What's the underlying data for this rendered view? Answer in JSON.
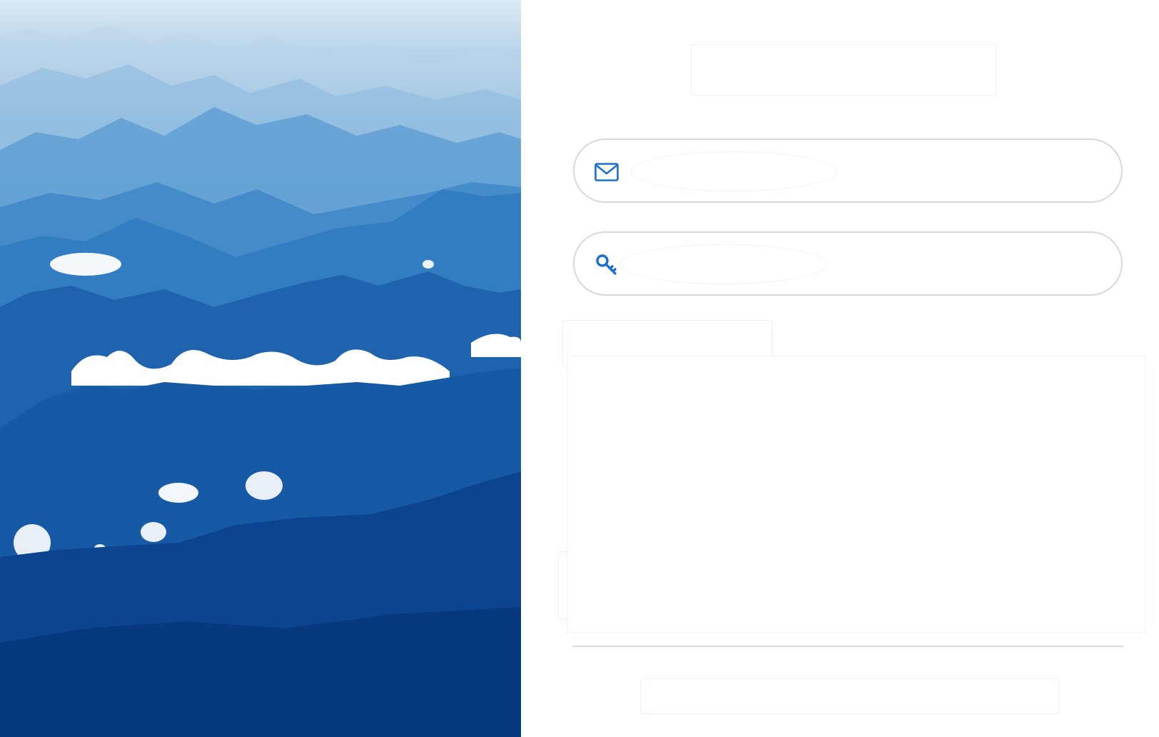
{
  "hero": {
    "image": "mountain-range-with-clouds"
  },
  "login": {
    "email": {
      "icon": "envelope-icon",
      "value": "",
      "placeholder": ""
    },
    "password": {
      "icon": "key-icon",
      "value": "",
      "placeholder": ""
    }
  },
  "colors": {
    "accent": "#1a6fd6",
    "field_border": "#d9d9d9",
    "divider": "#d9d9d9"
  }
}
